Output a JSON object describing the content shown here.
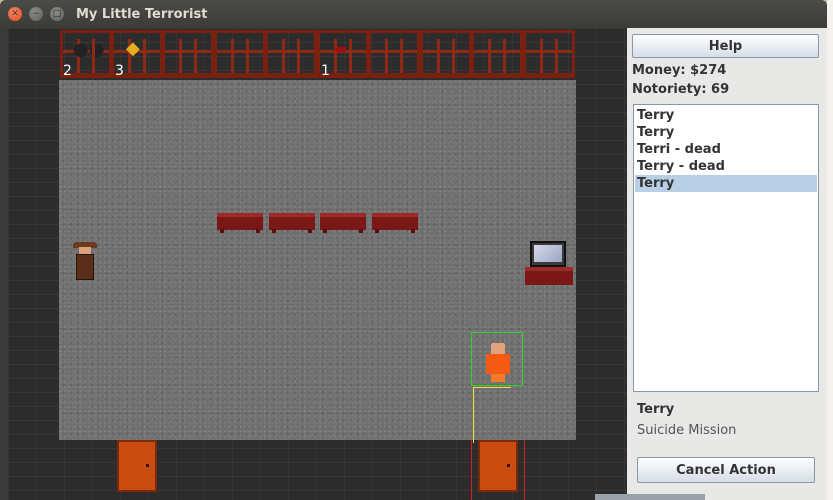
{
  "window": {
    "title": "My Little Terrorist"
  },
  "inventory": [
    {
      "icon": "explosives-icon",
      "count": "2"
    },
    {
      "icon": "gold-icon",
      "count": "3"
    },
    {
      "icon": "empty-slot",
      "count": ""
    },
    {
      "icon": "empty-slot",
      "count": ""
    },
    {
      "icon": "empty-slot",
      "count": ""
    },
    {
      "icon": "bomb-vest-icon",
      "count": "1"
    },
    {
      "icon": "empty-slot",
      "count": ""
    },
    {
      "icon": "empty-slot",
      "count": ""
    },
    {
      "icon": "empty-slot",
      "count": ""
    },
    {
      "icon": "empty-slot",
      "count": ""
    }
  ],
  "panel": {
    "help_label": "Help",
    "money": "Money: $274",
    "notoriety": "Notoriety: 69",
    "units": [
      {
        "label": "Terry",
        "selected": false
      },
      {
        "label": "Terry",
        "selected": false
      },
      {
        "label": "Terri - dead",
        "selected": false
      },
      {
        "label": "Terry - dead",
        "selected": false
      },
      {
        "label": "Terry",
        "selected": true
      }
    ],
    "selected_name": "Terry",
    "selected_action": "Suicide Mission",
    "cancel_label": "Cancel Action"
  },
  "colors": {
    "selection": "#2fd12f",
    "path": "#e8e232",
    "terry": "#f55a12",
    "furniture": "#7a1818"
  }
}
